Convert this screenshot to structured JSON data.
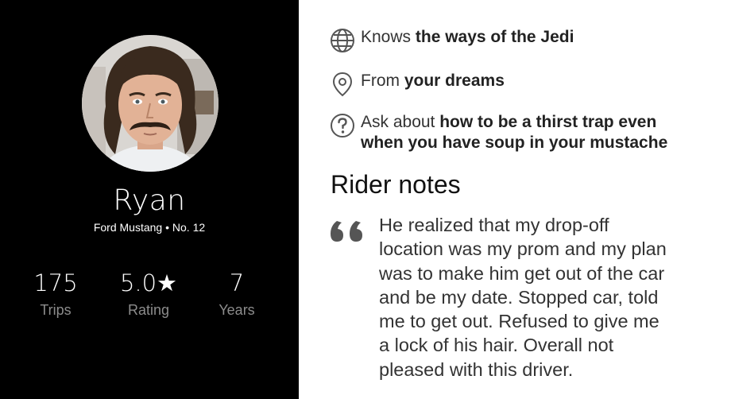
{
  "driver": {
    "name": "Ryan",
    "vehicle": "Ford Mustang • No. 12",
    "stats": [
      {
        "value": "175",
        "label": "Trips"
      },
      {
        "value": "5.0★",
        "label": "Rating"
      },
      {
        "value": "7",
        "label": "Years"
      }
    ]
  },
  "facts": [
    {
      "icon": "globe-icon",
      "prefix": "Knows ",
      "bold_lines": [
        "the ways of the Jedi"
      ]
    },
    {
      "icon": "location-pin-icon",
      "prefix": "From ",
      "bold_lines": [
        "your dreams"
      ]
    },
    {
      "icon": "question-icon",
      "prefix": "Ask about ",
      "bold_lines": [
        "how to be a thirst trap even",
        "when you have soup in your mustache"
      ]
    }
  ],
  "rider_notes": {
    "heading": "Rider notes",
    "quote_icon": "quote-icon",
    "lines": [
      "He realized that my drop-off",
      "location was my prom and my plan",
      "was to make him get out of the car",
      "and be my date. Stopped car, told",
      "me to get out. Refused to give me",
      "a lock of his hair. Overall not",
      "pleased with this driver."
    ]
  },
  "colors": {
    "profile_bg": "#000000",
    "stat_label": "#8c8c8c",
    "body_text": "#333333",
    "icon_gray": "#555555"
  }
}
